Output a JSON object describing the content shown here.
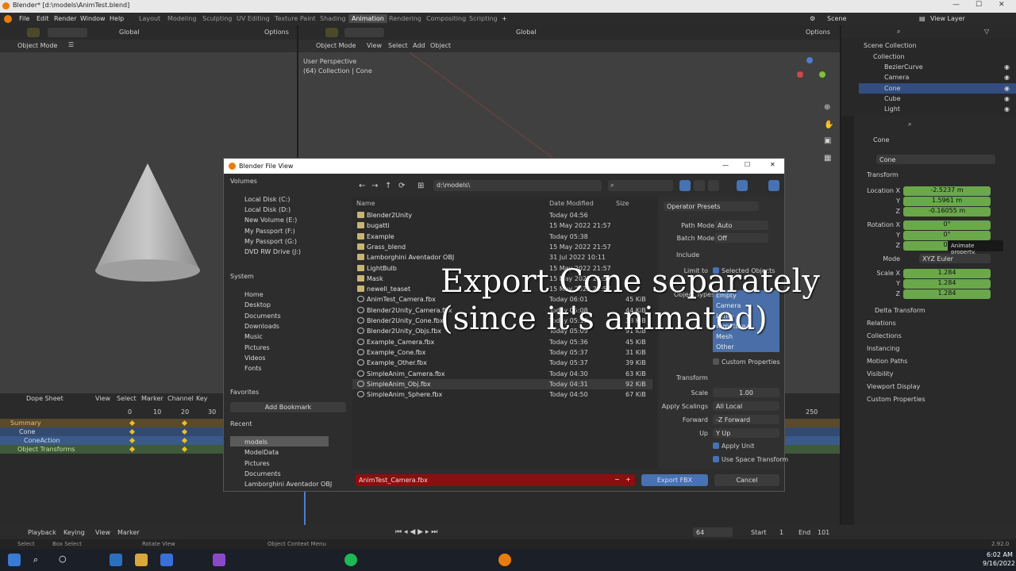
{
  "window": {
    "title": "Blender* [d:\\models\\AnimTest.blend]"
  },
  "menu": [
    "File",
    "Edit",
    "Render",
    "Window",
    "Help"
  ],
  "workspaces": [
    "Layout",
    "Modeling",
    "Sculpting",
    "UV Editing",
    "Texture Paint",
    "Shading",
    "Animation",
    "Rendering",
    "Compositing",
    "Scripting"
  ],
  "active_workspace": "Animation",
  "scene": {
    "label": "Scene",
    "view_layer": "View Layer"
  },
  "left_view": {
    "mode": "Object Mode",
    "orientation": "Global",
    "options": "Options"
  },
  "right_view": {
    "mode": "Object Mode",
    "orientation": "Global",
    "options": "Options",
    "menus": [
      "View",
      "Select",
      "Add",
      "Object"
    ],
    "overlay_title": "User Perspective",
    "overlay_sub": "(64) Collection | Cone"
  },
  "outliner": {
    "root": "Scene Collection",
    "collection": "Collection",
    "items": [
      "BezierCurve",
      "Camera",
      "Cone",
      "Cube",
      "Light"
    ],
    "selected": "Cone"
  },
  "properties": {
    "object_name": "Cone",
    "object_field": "Cone",
    "transform_header": "Transform",
    "location_label": "Location X",
    "location": [
      "-2.5237 m",
      "1.5961 m",
      "-0.16055 m"
    ],
    "rotation_label": "Rotation X",
    "rotation": [
      "0°",
      "0°",
      "0°"
    ],
    "mode_label": "Mode",
    "mode_value": "XYZ Euler",
    "scale_label": "Scale X",
    "scale": [
      "1.284",
      "1.284",
      "1.284"
    ],
    "axis_y": "Y",
    "axis_z": "Z",
    "tooltip": "Animate property.",
    "sections": [
      "Delta Transform",
      "Relations",
      "Collections",
      "Instancing",
      "Motion Paths",
      "Visibility",
      "Viewport Display",
      "Custom Properties"
    ]
  },
  "dopesheet": {
    "mode": "Dope Sheet",
    "menus": [
      "View",
      "Select",
      "Marker",
      "Channel",
      "Key"
    ],
    "frames": [
      "0",
      "10",
      "20",
      "30"
    ],
    "channels": [
      "Summary",
      "Cone",
      "ConeAction",
      "Object Transforms"
    ],
    "right_frames": [
      "250"
    ]
  },
  "timeline": {
    "playback": "Playback",
    "keying": "Keying",
    "view": "View",
    "marker": "Marker",
    "current_frame": "64",
    "start_label": "Start",
    "start": "1",
    "end_label": "End",
    "end": "101"
  },
  "status": {
    "select": "Select",
    "box_select": "Box Select",
    "rotate_view": "Rotate View",
    "context": "Object Context Menu",
    "version": "2.92.0"
  },
  "dialog": {
    "title": "Blender File View",
    "path": "d:\\models\\",
    "volumes_header": "Volumes",
    "volumes": [
      "Local Disk (C:)",
      "Local Disk (D:)",
      "New Volume (E:)",
      "My Passport (F:)",
      "My Passport (G:)",
      "DVD RW Drive (J:)"
    ],
    "system_header": "System",
    "system": [
      "Home",
      "Desktop",
      "Documents",
      "Downloads",
      "Music",
      "Pictures",
      "Videos",
      "Fonts"
    ],
    "favorites_header": "Favorites",
    "add_bookmark": "Add Bookmark",
    "recent_header": "Recent",
    "recent": [
      "models",
      "ModelData",
      "Pictures",
      "Documents",
      "Lamborghini Aventador OBJ"
    ],
    "columns": {
      "name": "Name",
      "date": "Date Modified",
      "size": "Size"
    },
    "files": [
      {
        "name": "Blender2Unity",
        "date": "Today 04:56",
        "size": "",
        "folder": true
      },
      {
        "name": "bugatti",
        "date": "15 May 2022 21:57",
        "size": "",
        "folder": true
      },
      {
        "name": "Example",
        "date": "Today 05:38",
        "size": "",
        "folder": true
      },
      {
        "name": "Grass_blend",
        "date": "15 May 2022 21:57",
        "size": "",
        "folder": true
      },
      {
        "name": "Lamborghini Aventador OBJ",
        "date": "31 Jul 2022 10:11",
        "size": "",
        "folder": true
      },
      {
        "name": "LightBulb",
        "date": "15 May 2022 21:57",
        "size": "",
        "folder": true
      },
      {
        "name": "Mask",
        "date": "15 May 2022 21:57",
        "size": "",
        "folder": true
      },
      {
        "name": "newell_teaset",
        "date": "15 May 2022 21:57",
        "size": "",
        "folder": true
      },
      {
        "name": "AnimTest_Camera.fbx",
        "date": "Today 06:01",
        "size": "45 KiB",
        "folder": false
      },
      {
        "name": "Blender2Unity_Camera.fbx",
        "date": "Today 05:08",
        "size": "44 KiB",
        "folder": false
      },
      {
        "name": "Blender2Unity_Cone.fbx",
        "date": "Today 05:13",
        "size": "38 KiB",
        "folder": false
      },
      {
        "name": "Blender2Unity_Objs.fbx",
        "date": "Today 05:09",
        "size": "91 KiB",
        "folder": false
      },
      {
        "name": "Example_Camera.fbx",
        "date": "Today 05:36",
        "size": "45 KiB",
        "folder": false
      },
      {
        "name": "Example_Cone.fbx",
        "date": "Today 05:37",
        "size": "31 KiB",
        "folder": false
      },
      {
        "name": "Example_Other.fbx",
        "date": "Today 05:37",
        "size": "39 KiB",
        "folder": false
      },
      {
        "name": "SimpleAnim_Camera.fbx",
        "date": "Today 04:30",
        "size": "63 KiB",
        "folder": false
      },
      {
        "name": "SimpleAnim_Obj.fbx",
        "date": "Today 04:31",
        "size": "92 KiB",
        "folder": false
      },
      {
        "name": "SimpleAnim_Sphere.fbx",
        "date": "Today 04:50",
        "size": "67 KiB",
        "folder": false
      }
    ],
    "operator_presets": "Operator Presets",
    "path_mode_label": "Path Mode",
    "path_mode": "Auto",
    "batch_mode_label": "Batch Mode",
    "batch_mode": "Off",
    "include_header": "Include",
    "limit_to_label": "Limit to",
    "selected_objects": "Selected Objects",
    "object_types_label": "Object Types",
    "object_types": [
      "Empty",
      "Camera",
      "Lamp",
      "Armature",
      "Mesh",
      "Other"
    ],
    "custom_properties": "Custom Properties",
    "transform_header": "Transform",
    "scale_label": "Scale",
    "scale": "1.00",
    "apply_scalings_label": "Apply Scalings",
    "apply_scalings": "All Local",
    "forward_label": "Forward",
    "forward": "-Z Forward",
    "up_label": "Up",
    "up": "Y Up",
    "apply_unit": "Apply Unit",
    "use_space_transform": "Use Space Transform",
    "filename": "AnimTest_Camera.fbx",
    "export_button": "Export FBX",
    "cancel_button": "Cancel"
  },
  "caption": {
    "line1": "Export Cone separately",
    "line2": "(since it's animated)"
  },
  "clock": {
    "time": "6:02 AM",
    "date": "9/16/2022"
  },
  "colors": {
    "accent": "#4772b3",
    "keyframe_green": "#6aa84a",
    "filename_error": "#8b0f0f"
  }
}
